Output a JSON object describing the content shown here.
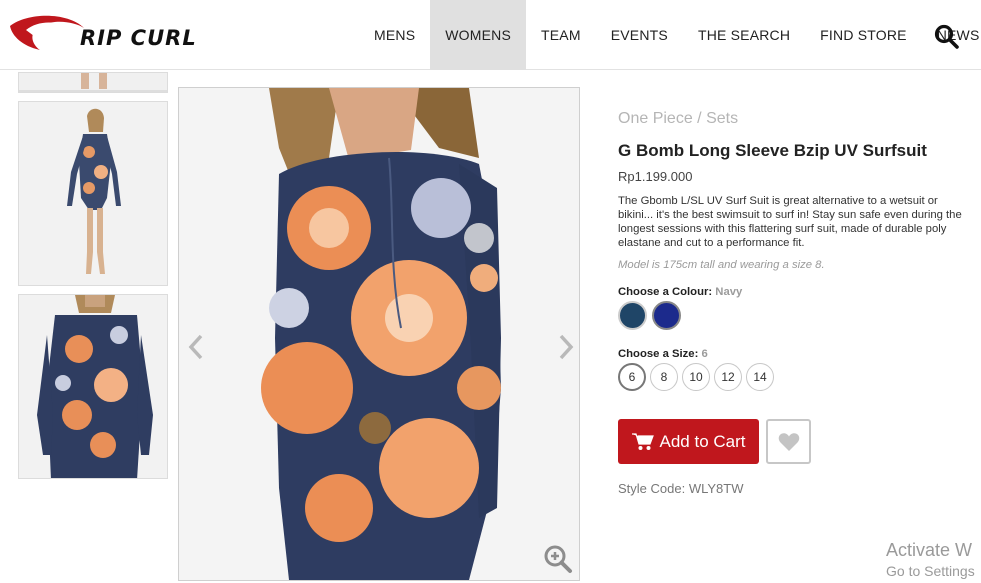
{
  "header": {
    "logo_text": "RIP CURL",
    "nav": [
      {
        "label": "MENS",
        "active": false
      },
      {
        "label": "WOMENS",
        "active": true
      },
      {
        "label": "TEAM",
        "active": false
      },
      {
        "label": "EVENTS",
        "active": false
      },
      {
        "label": "THE SEARCH",
        "active": false
      },
      {
        "label": "FIND STORE",
        "active": false
      },
      {
        "label": "NEWS",
        "active": false
      }
    ],
    "search_icon": "search-icon"
  },
  "product": {
    "breadcrumb": [
      "One Piece",
      "Sets"
    ],
    "breadcrumb_sep": " / ",
    "title": "G Bomb Long Sleeve Bzip UV Surfsuit",
    "price": "Rp1.199.000",
    "description": "The Gbomb L/SL UV Surf Suit is great alternative to a wetsuit or bikini... it's the best swimsuit to surf in! Stay sun safe even during the longest sessions with this flattering surf suit, made of durable poly elastane and cut to a performance fit.",
    "model_note": "Model is 175cm tall and wearing a size 8.",
    "colour_label": "Choose a Colour:",
    "colour_selected": "Navy",
    "colours": [
      {
        "name": "dark-teal",
        "hex": "#1f4567"
      },
      {
        "name": "navy",
        "hex": "#1c2a8c"
      }
    ],
    "size_label": "Choose a Size:",
    "size_selected": "6",
    "sizes": [
      "6",
      "8",
      "10",
      "12",
      "14"
    ],
    "add_to_cart": "Add to Cart",
    "style_code": "Style Code: WLY8TW"
  },
  "colors": {
    "accent": "#c0171d",
    "logo_red": "#c0171d",
    "nav_active_bg": "#e0e0e0"
  },
  "watermark": {
    "line1": "Activate W",
    "line2": "Go to Settings"
  }
}
